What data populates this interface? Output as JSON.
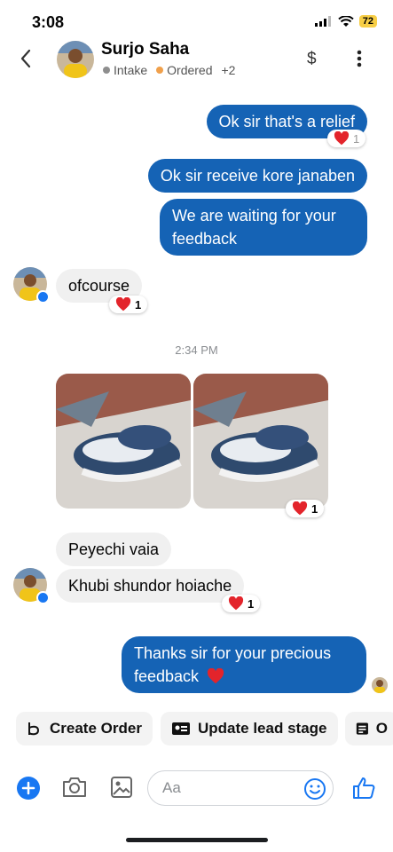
{
  "status": {
    "time": "3:08",
    "battery": "72"
  },
  "header": {
    "name": "Surjo Saha",
    "tag1": "Intake",
    "tag2": "Ordered",
    "more": "+2",
    "dollar": "$",
    "colors": {
      "tag1": "#8e8e8e",
      "tag2": "#f0a04b"
    }
  },
  "messages": {
    "m1": {
      "text": "Ok sir that's a relief",
      "reaction_count": "1"
    },
    "m2": {
      "text": "Ok sir receive kore janaben"
    },
    "m3": {
      "text": "We are waiting for your feedback"
    },
    "m4": {
      "text": "ofcourse",
      "reaction_count": "1"
    },
    "timestamp": "2:34 PM",
    "photos_reaction_count": "1",
    "m5": {
      "text": "Peyechi vaia"
    },
    "m6": {
      "text": "Khubi shundor hoiache",
      "reaction_count": "1"
    },
    "m7": {
      "text": "Thanks sir for your precious feedback"
    }
  },
  "actions": {
    "create_order": "Create Order",
    "update_lead": "Update lead stage",
    "third": "O"
  },
  "composer": {
    "placeholder": "Aa"
  },
  "colors": {
    "accent": "#1563b5",
    "heart": "#e3242b"
  }
}
